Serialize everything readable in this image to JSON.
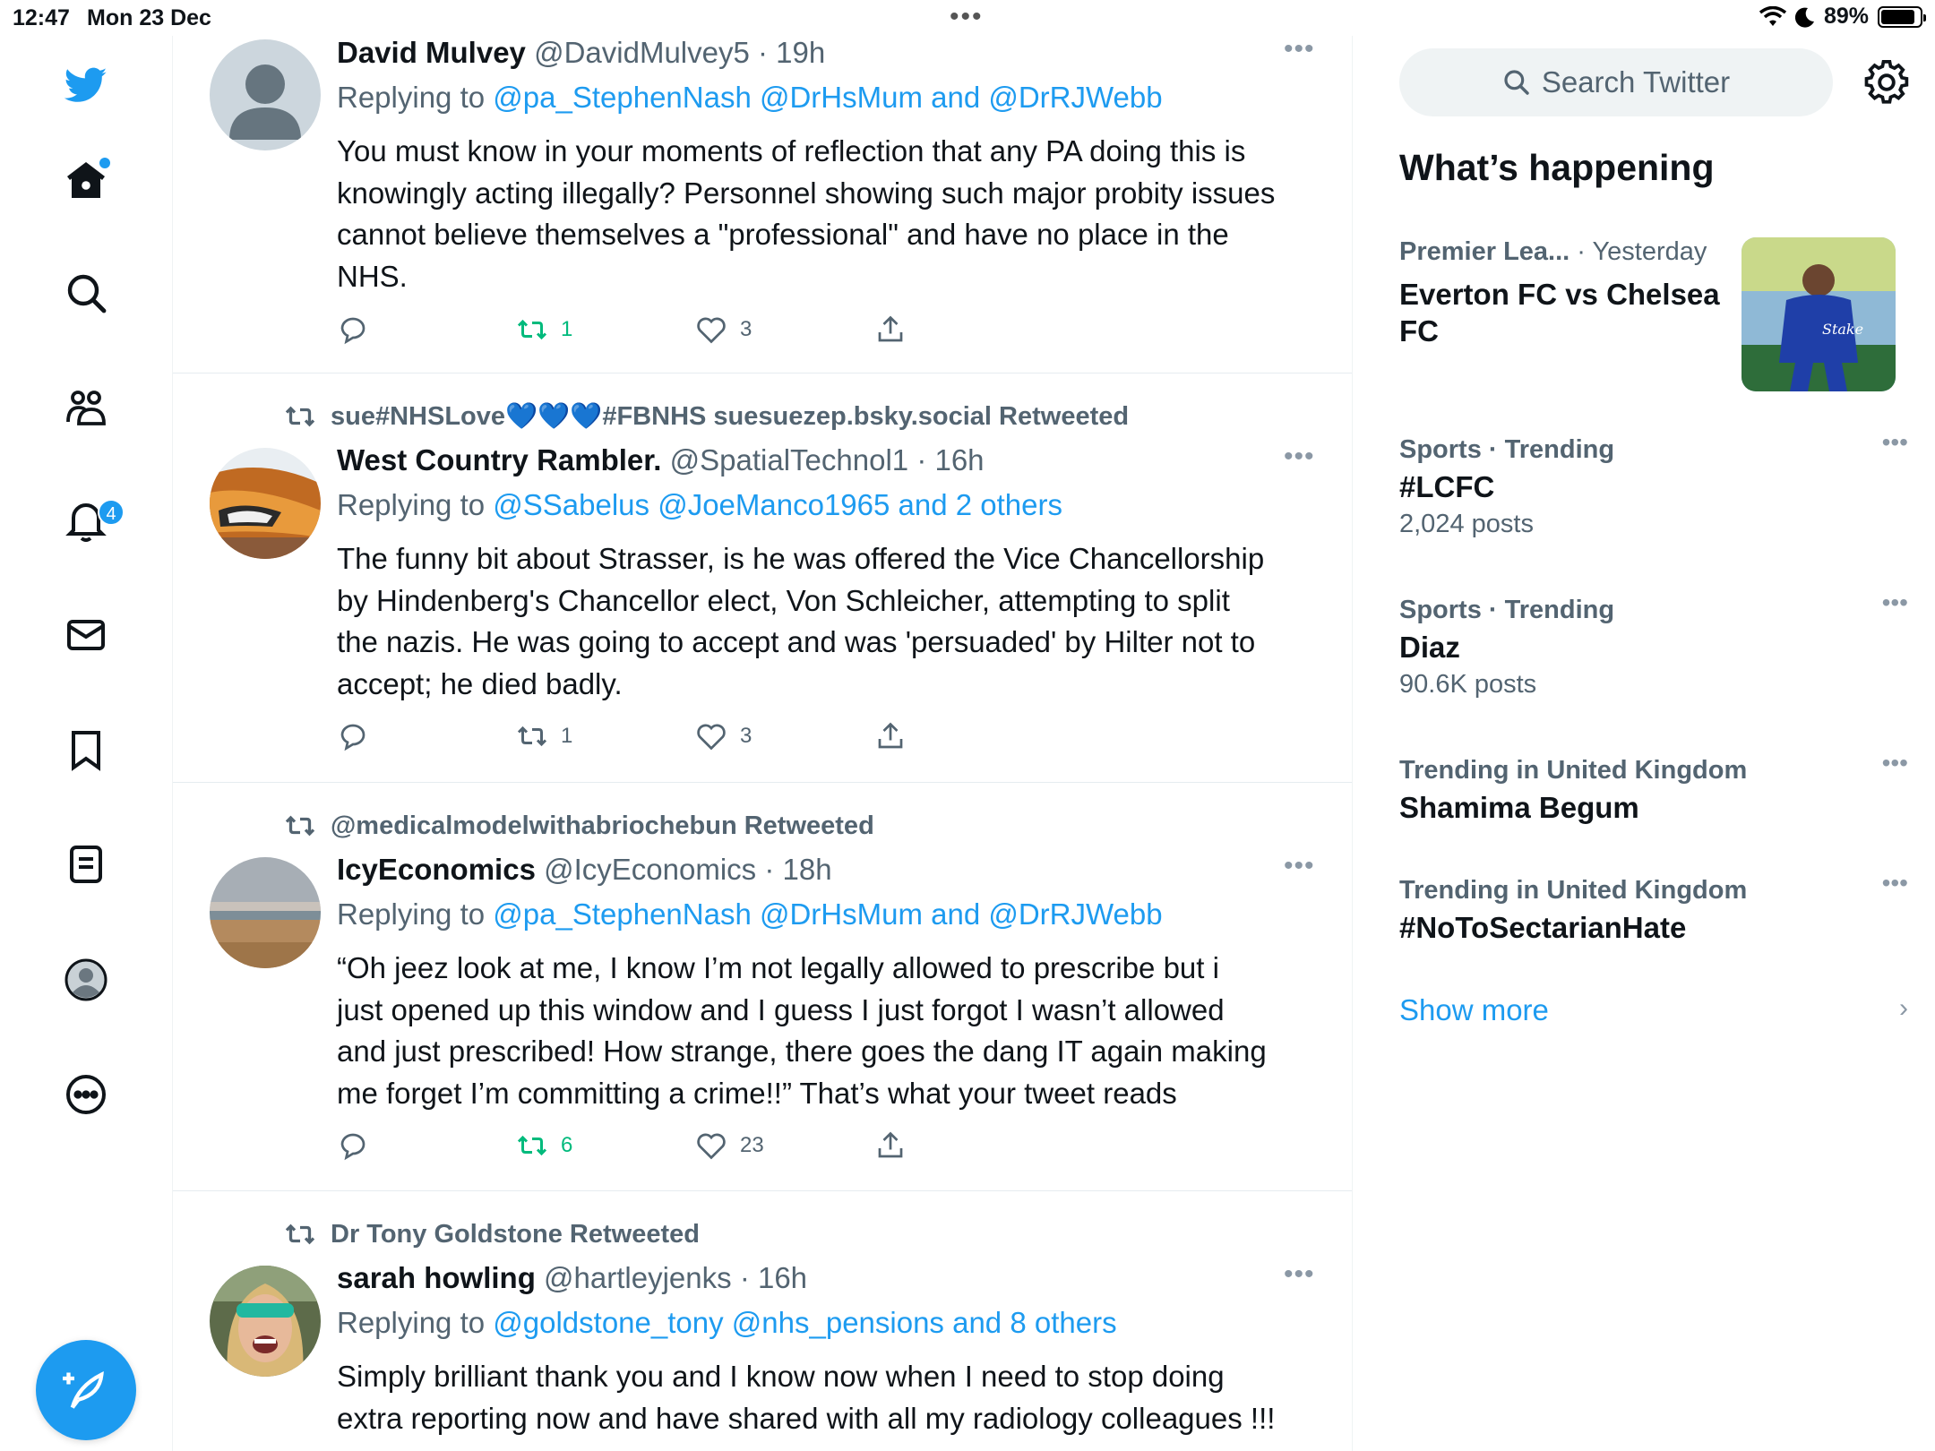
{
  "status_bar": {
    "time": "12:47",
    "date": "Mon 23 Dec",
    "battery": "89%",
    "battery_level": 0.89
  },
  "nav": {
    "notifications_badge": "4"
  },
  "tweets": [
    {
      "retweeted_by": "",
      "name": "David Mulvey",
      "handle": "@DavidMulvey5",
      "time": "· 19h",
      "replying_prefix": "Replying to ",
      "replying_mentions": "@pa_StephenNash @DrHsMum and @DrRJWebb",
      "text": "You must know in your moments of reflection that any PA doing this is\nknowingly acting illegally? Personnel showing such major probity issues\ncannot believe themselves a \"professional\" and have no place in the\nNHS.",
      "retweets": "1",
      "likes": "3"
    },
    {
      "retweeted_by": "sue#NHSLove💙💙💙#FBNHS suesuezep.bsky.social Retweeted",
      "name": "West Country Rambler.",
      "handle": "@SpatialTechnol1",
      "time": "· 16h",
      "replying_prefix": "Replying to ",
      "replying_mentions": "@SSabelus @JoeManco1965 and 2 others",
      "text": "The funny bit about Strasser, is he was offered the Vice Chancellorship\nby Hindenberg's Chancellor elect, Von Schleicher, attempting to split\nthe nazis.  He was going to accept and was 'persuaded' by Hilter not to\naccept; he died badly.",
      "retweets": "1",
      "likes": "3"
    },
    {
      "retweeted_by": "@medicalmodelwithabriochebun Retweeted",
      "name": "IcyEconomics",
      "handle": "@IcyEconomics",
      "time": "· 18h",
      "replying_prefix": "Replying to ",
      "replying_mentions": "@pa_StephenNash @DrHsMum and @DrRJWebb",
      "text": "“Oh jeez look at me, I know I’m not legally allowed to prescribe but i\njust opened up this window and I guess I just forgot I wasn’t allowed\nand just prescribed! How strange, there goes the dang IT again making\nme forget I’m committing a crime!!” That’s what your tweet reads",
      "retweets": "6",
      "likes": "23"
    },
    {
      "retweeted_by": "Dr Tony Goldstone Retweeted",
      "name": "sarah howling",
      "handle": "@hartleyjenks",
      "time": "· 16h",
      "replying_prefix": "Replying to ",
      "replying_mentions": "@goldstone_tony @nhs_pensions and 8 others",
      "text": "Simply brilliant thank you and I know now when I need to stop doing\nextra reporting now and have shared with all my radiology colleagues !!!",
      "retweets": "",
      "likes": ""
    }
  ],
  "sidebar": {
    "search_placeholder": "Search Twitter",
    "whats_happening": "What’s happening",
    "featured": {
      "category": "Premier Lea...",
      "time": "· Yesterday",
      "headline": "Everton FC vs Chelsea FC"
    },
    "trends": [
      {
        "meta": "Sports · Trending",
        "name": "#LCFC",
        "count": "2,024 posts"
      },
      {
        "meta": "Sports · Trending",
        "name": "Diaz",
        "count": "90.6K posts"
      },
      {
        "meta": "Trending in United Kingdom",
        "name": "Shamima Begum",
        "count": ""
      },
      {
        "meta": "Trending in United Kingdom",
        "name": "#NoToSectarianHate",
        "count": ""
      }
    ],
    "show_more": "Show more"
  },
  "colors": {
    "accent": "#1d9bf0",
    "retweet_active": "#00ba7c",
    "secondary_text": "#536471"
  }
}
